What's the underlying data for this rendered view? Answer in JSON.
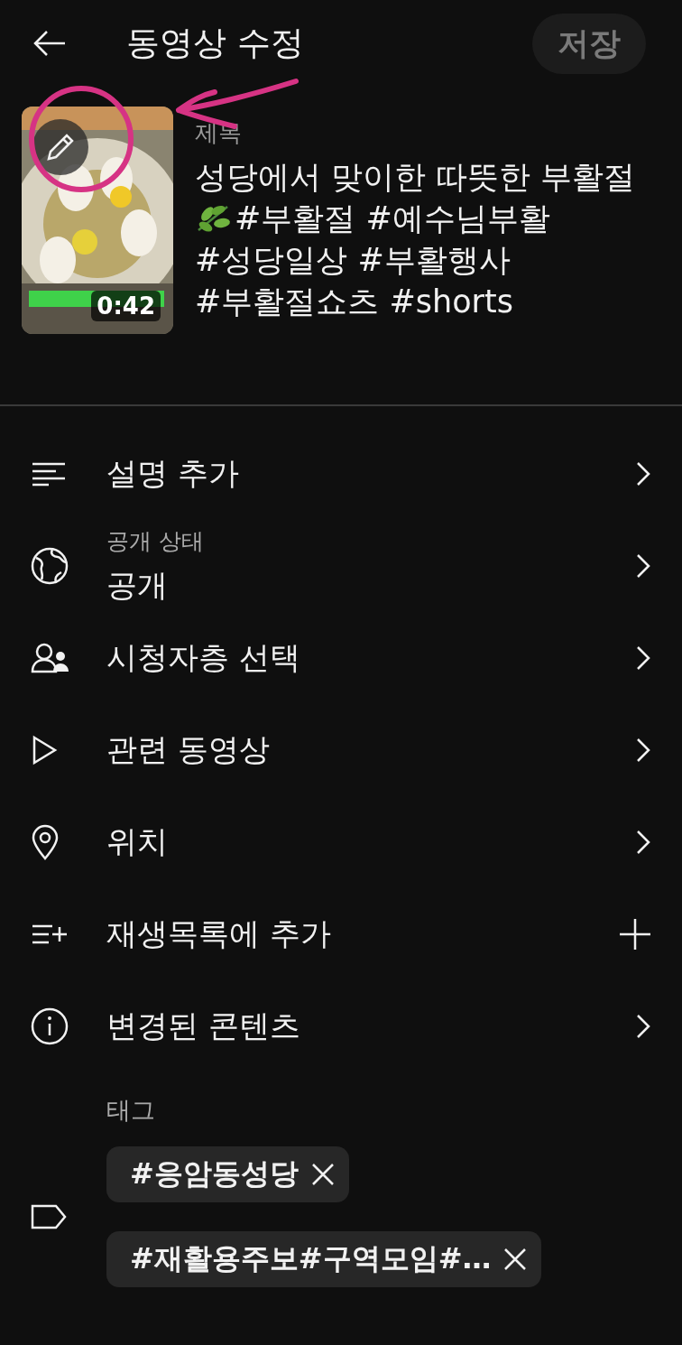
{
  "header": {
    "title": "동영상 수정",
    "save_button": {
      "label": "저장",
      "disabled": true
    }
  },
  "video": {
    "thumbnail": {
      "kind": "picture",
      "duration": "0:42"
    },
    "title_label": "제목",
    "title_lines": [
      "성당에서 맞이한 따뜻한 부활절",
      "#부활절 #예수님부활",
      "#성당일상 #부활행사",
      "#부활절쇼츠 #shorts"
    ]
  },
  "menu": [
    {
      "kind": "nav",
      "label": "설명 추가"
    },
    {
      "kind": "nav",
      "caption": "공개 상태",
      "label": "공개"
    },
    {
      "kind": "nav",
      "label": "시청자층 선택"
    },
    {
      "kind": "nav",
      "label": "관련 동영상"
    },
    {
      "kind": "nav",
      "label": "위치"
    },
    {
      "kind": "add",
      "label": "재생목록에 추가"
    },
    {
      "kind": "nav",
      "label": "변경된 콘텐츠"
    }
  ],
  "tags": {
    "label": "태그",
    "items": [
      "#응암동성당",
      "#재활용주보#구역모임#…"
    ]
  }
}
